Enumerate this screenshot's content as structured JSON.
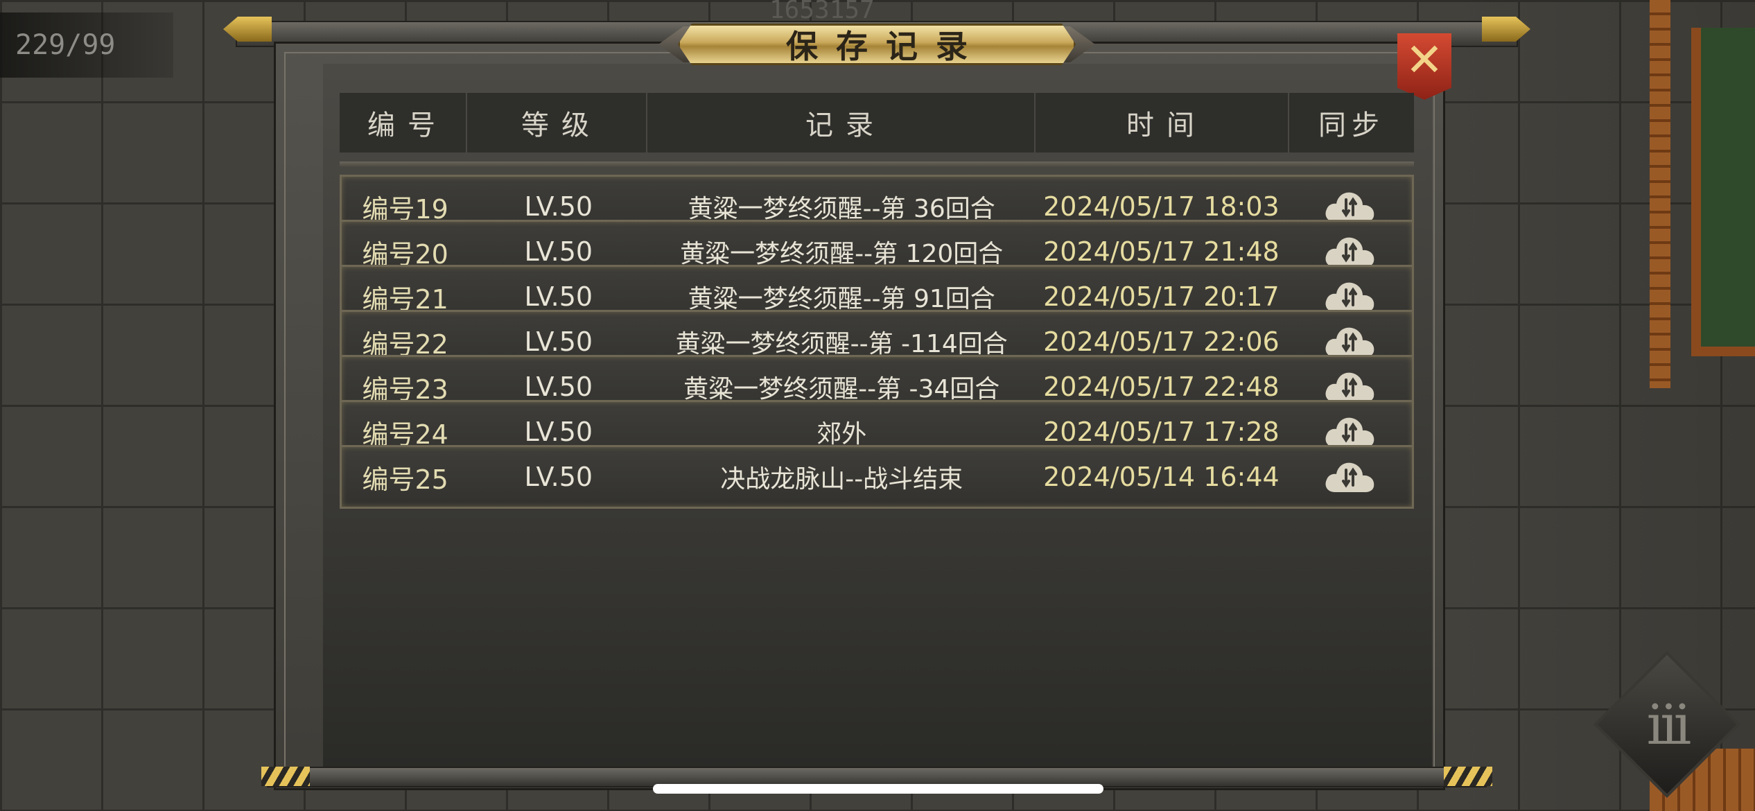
{
  "hud": {
    "counter": "229/99",
    "top_number": "1653157"
  },
  "dialog": {
    "title": "保存记录",
    "close_label": "✕",
    "columns": [
      "编号",
      "等级",
      "记录",
      "时间",
      "同步"
    ],
    "rows": [
      {
        "id": "编号19",
        "level": "LV.50",
        "record": "黄粱一梦终须醒--第 36回合",
        "time": "2024/05/17 18:03",
        "sync_icon": "cloud-sync-icon"
      },
      {
        "id": "编号20",
        "level": "LV.50",
        "record": "黄粱一梦终须醒--第 120回合",
        "time": "2024/05/17 21:48",
        "sync_icon": "cloud-sync-icon"
      },
      {
        "id": "编号21",
        "level": "LV.50",
        "record": "黄粱一梦终须醒--第 91回合",
        "time": "2024/05/17 20:17",
        "sync_icon": "cloud-sync-icon"
      },
      {
        "id": "编号22",
        "level": "LV.50",
        "record": "黄粱一梦终须醒--第 -114回合",
        "time": "2024/05/17 22:06",
        "sync_icon": "cloud-sync-icon"
      },
      {
        "id": "编号23",
        "level": "LV.50",
        "record": "黄粱一梦终须醒--第 -34回合",
        "time": "2024/05/17 22:48",
        "sync_icon": "cloud-sync-icon"
      },
      {
        "id": "编号24",
        "level": "LV.50",
        "record": "郊外",
        "time": "2024/05/17 17:28",
        "sync_icon": "cloud-sync-icon"
      },
      {
        "id": "编号25",
        "level": "LV.50",
        "record": "决战龙脉山--战斗结束",
        "time": "2024/05/14 16:44",
        "sync_icon": "cloud-sync-icon"
      }
    ]
  },
  "menu_button": {
    "label": "iii",
    "icon": "menu-icon"
  },
  "colors": {
    "accent_gold": "#e6c35a",
    "close_red": "#c03a26",
    "row_border": "#6e6754",
    "time_text": "#e6dca0"
  }
}
